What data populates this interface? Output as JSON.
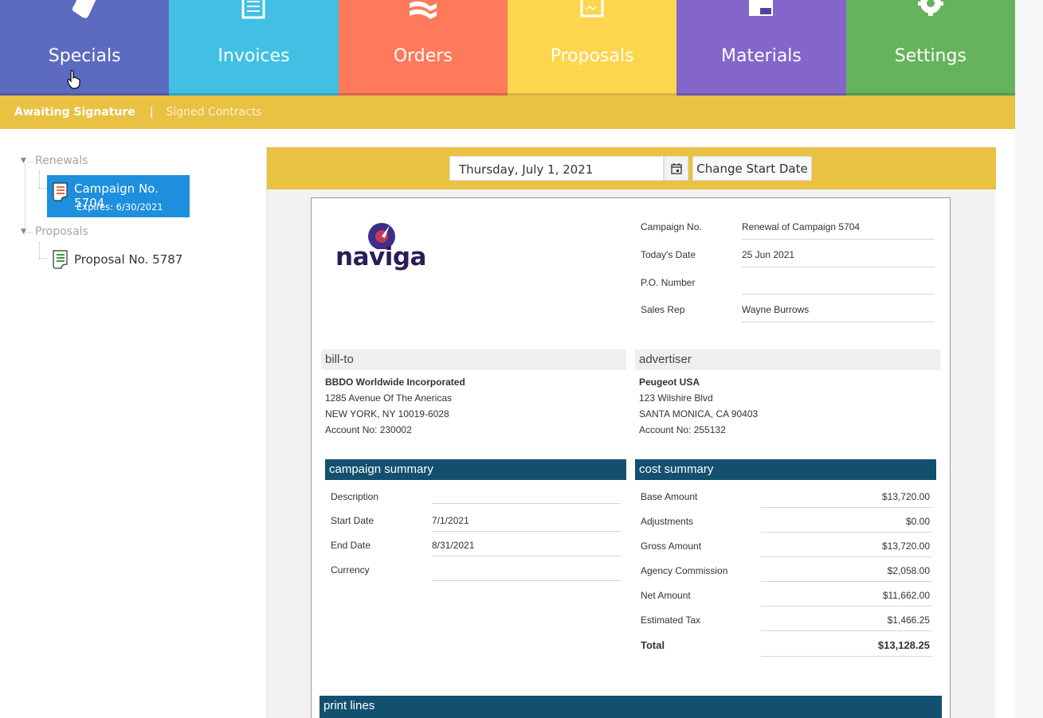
{
  "nav": {
    "tiles": [
      {
        "label": "Specials",
        "color": "#5c6bc0",
        "icon": "tag-icon"
      },
      {
        "label": "Invoices",
        "color": "#41c0e4",
        "icon": "invoice-icon"
      },
      {
        "label": "Orders",
        "color": "#fe7a5a",
        "icon": "orders-icon"
      },
      {
        "label": "Proposals",
        "color": "#fdd64d",
        "icon": "proposal-icon"
      },
      {
        "label": "Materials",
        "color": "#8465c9",
        "icon": "materials-icon"
      },
      {
        "label": "Settings",
        "color": "#65b35c",
        "icon": "gear-icon"
      }
    ]
  },
  "subnav": {
    "active": "Awaiting Signature",
    "separator": "|",
    "inactive": "Signed Contracts"
  },
  "tree": {
    "renewals_label": "Renewals",
    "selected_item": {
      "title": "Campaign No. 5704",
      "subtitle": "Expires: 6/30/2021"
    },
    "proposals_label": "Proposals",
    "proposal_item": {
      "title": "Proposal No. 5787"
    }
  },
  "toolbar": {
    "date_value": "Thursday, July 1, 2021",
    "change_button": "Change Start Date"
  },
  "doc": {
    "logo_text": "naviga",
    "meta": [
      {
        "key": "Campaign No.",
        "value": "Renewal of Campaign 5704"
      },
      {
        "key": "Today's Date",
        "value": "25 Jun 2021"
      },
      {
        "key": "P.O. Number",
        "value": ""
      },
      {
        "key": "Sales Rep",
        "value": "Wayne Burrows"
      }
    ],
    "bill_to": {
      "heading": "bill-to",
      "name": "BBDO Worldwide Incorporated",
      "line1": "1285 Avenue Of The Anericas",
      "line2": "NEW YORK, NY 10019-6028",
      "account": "Account No: 230002"
    },
    "advertiser": {
      "heading": "advertiser",
      "name": "Peugeot USA",
      "line1": "123 Wilshire Blvd",
      "line2": "SANTA MONICA, CA 90403",
      "account": "Account No: 255132"
    },
    "campaign_summary": {
      "heading": "campaign summary",
      "rows": [
        {
          "key": "Description",
          "value": ""
        },
        {
          "key": "Start Date",
          "value": "7/1/2021"
        },
        {
          "key": "End Date",
          "value": "8/31/2021"
        },
        {
          "key": "Currency",
          "value": ""
        }
      ]
    },
    "cost_summary": {
      "heading": "cost summary",
      "rows": [
        {
          "key": "Base Amount",
          "value": "$13,720.00"
        },
        {
          "key": "Adjustments",
          "value": "$0.00"
        },
        {
          "key": "Gross Amount",
          "value": "$13,720.00"
        },
        {
          "key": "Agency Commission",
          "value": "$2,058.00"
        },
        {
          "key": "Net Amount",
          "value": "$11,662.00"
        },
        {
          "key": "Estimated Tax",
          "value": "$1,466.25"
        }
      ],
      "total_key": "Total",
      "total_value": "$13,128.25"
    },
    "print_lines_heading": "print lines"
  }
}
